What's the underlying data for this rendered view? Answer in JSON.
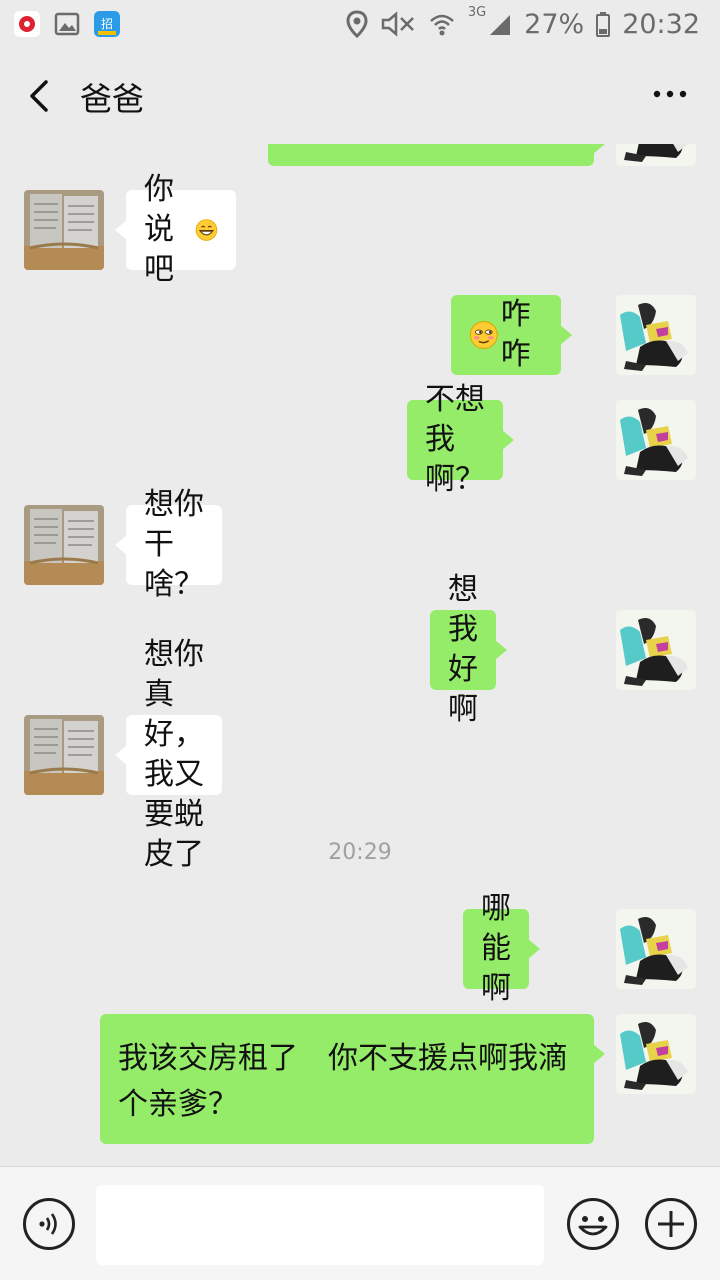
{
  "status_bar": {
    "battery": "27%",
    "time": "20:32",
    "network": "3G",
    "icons": [
      "app-red-icon",
      "gallery-icon",
      "app-blue-icon",
      "location-icon",
      "mute-icon",
      "wifi-icon",
      "signal-icon",
      "battery-icon"
    ]
  },
  "header": {
    "title": "爸爸",
    "back_icon": "back-chevron-icon",
    "more_icon": "more-dots-icon"
  },
  "messages": [
    {
      "side": "me",
      "text": ""
    },
    {
      "side": "them",
      "text": "你说吧",
      "emoji_after": "grinning-face-emoji"
    },
    {
      "side": "me",
      "text": "咋咋",
      "emoji_before": "smirking-face-emoji"
    },
    {
      "side": "me",
      "text": "不想我啊？"
    },
    {
      "side": "them",
      "text": "想你干啥？"
    },
    {
      "side": "me",
      "text": "想我好啊"
    },
    {
      "side": "them",
      "text": "想你真好，我又要蜕皮了"
    },
    {
      "side": "me",
      "text": "哪能啊"
    },
    {
      "side": "me",
      "text": "我该交房租了　你不支援点啊我滴个亲爹？"
    }
  ],
  "timestamp": "20:29",
  "input_bar": {
    "value": "",
    "icons": [
      "voice-icon",
      "emoji-icon",
      "plus-icon"
    ]
  },
  "colors": {
    "background": "#ebebeb",
    "my_bubble": "#95ec69",
    "their_bubble": "#ffffff",
    "timestamp": "#a0a0a0"
  }
}
